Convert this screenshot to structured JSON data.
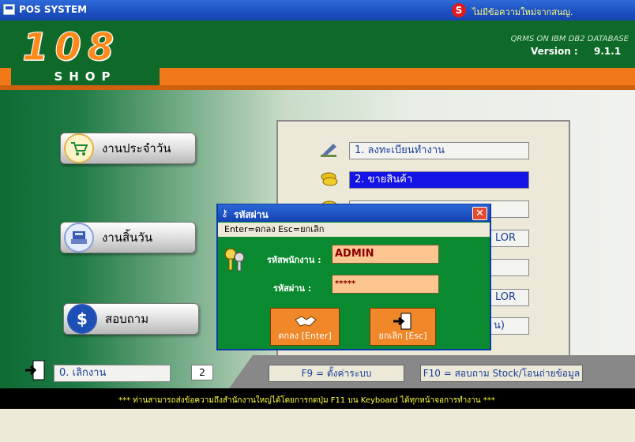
{
  "titlebar": {
    "title": "POS SYSTEM",
    "notice": "ไม่มีข้อความใหม่จากสนญ."
  },
  "header": {
    "logo_number": "108",
    "logo_shop": "SHOP",
    "db_text": "QRMS ON IBM DB2 DATABASE",
    "version_label": "Version :",
    "version_value": "9.1.1"
  },
  "main_buttons": {
    "daily": "งานประจำวัน",
    "end_of_day": "งานสิ้นวัน",
    "inquiry": "สอบถาม"
  },
  "menu": {
    "items": [
      {
        "label": "1. ลงทะเบียนทำงาน",
        "selected": false
      },
      {
        "label": "2. ขายสินค้า",
        "selected": true
      },
      {
        "label": "",
        "selected": false
      },
      {
        "label": "LOR",
        "selected": false
      },
      {
        "label": "",
        "selected": false
      },
      {
        "label": "LOR",
        "selected": false
      },
      {
        "label": "น)",
        "selected": false
      }
    ],
    "exit_item": "0. เลิกงาน",
    "count": "2"
  },
  "function_keys": {
    "f9": "F9 = ตั้งค่าระบบ",
    "f10": "F10 = สอบถาม Stock/โอนถ่ายข้อมูล"
  },
  "status_text": "*** ท่านสามารถส่งข้อความถึงสำนักงานใหญ่ได้โดยการกดปุ่ม F11 บน Keyboard ได้ทุกหน้าจอการทำงาน ***",
  "dialog": {
    "title": "รหัสผ่าน",
    "help": "Enter=ตกลง   Esc=ยกเลิก",
    "user_label": "รหัสพนักงาน :",
    "user_value": "ADMIN",
    "pass_label": "รหัสผ่าน :",
    "pass_value": "*****",
    "ok_label": "ตกลง [Enter]",
    "cancel_label": "ยกเลิก [Esc]"
  },
  "colors": {
    "header_green": "#0f6a2a",
    "orange": "#f07818",
    "selected_blue": "#1414e6",
    "dialog_green": "#0a8a30"
  }
}
